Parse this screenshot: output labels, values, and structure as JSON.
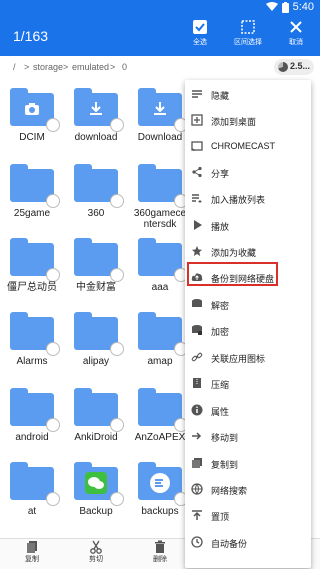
{
  "status": {
    "time": "5:40"
  },
  "appbar": {
    "count": "1/163",
    "select_all": "全选",
    "range_select": "区间选择",
    "cancel": "取消"
  },
  "breadcrumb": {
    "root": "/",
    "sep": ">",
    "storage": "storage",
    "emulated": "emulated",
    "current": "0",
    "storage_chip": "2.5..."
  },
  "files": [
    {
      "label": "DCIM",
      "glyph": "camera-icon"
    },
    {
      "label": "download",
      "glyph": "download-icon"
    },
    {
      "label": "Download",
      "glyph": "download-icon"
    },
    {
      "label": "25game",
      "glyph": ""
    },
    {
      "label": "360",
      "glyph": ""
    },
    {
      "label": "360gamece\nntersdk",
      "glyph": ""
    },
    {
      "label": "僵尸总动员",
      "glyph": ""
    },
    {
      "label": "中金财富",
      "glyph": ""
    },
    {
      "label": "aaa",
      "glyph": ""
    },
    {
      "label": "Alarms",
      "glyph": ""
    },
    {
      "label": "alipay",
      "glyph": ""
    },
    {
      "label": "amap",
      "glyph": ""
    },
    {
      "label": "android",
      "glyph": ""
    },
    {
      "label": "AnkiDroid",
      "glyph": ""
    },
    {
      "label": "AnZoAPEX",
      "glyph": ""
    },
    {
      "label": "at",
      "glyph": ""
    },
    {
      "label": "Backup",
      "glyph": "wechat-icon"
    },
    {
      "label": "backups",
      "glyph": "es-icon"
    }
  ],
  "menu": [
    {
      "label": "隐藏",
      "icon": "hide-icon"
    },
    {
      "label": "添加到桌面",
      "icon": "add-desktop-icon"
    },
    {
      "label": "CHROMECAST",
      "icon": "cast-icon"
    },
    {
      "label": "分享",
      "icon": "share-icon"
    },
    {
      "label": "加入播放列表",
      "icon": "playlist-icon"
    },
    {
      "label": "播放",
      "icon": "play-icon"
    },
    {
      "label": "添加为收藏",
      "icon": "star-icon"
    },
    {
      "label": "备份到网络硬盘",
      "icon": "cloud-upload-icon"
    },
    {
      "label": "解密",
      "icon": "decrypt-icon"
    },
    {
      "label": "加密",
      "icon": "encrypt-icon"
    },
    {
      "label": "关联应用图标",
      "icon": "link-icon"
    },
    {
      "label": "压缩",
      "icon": "compress-icon"
    },
    {
      "label": "属性",
      "icon": "info-icon"
    },
    {
      "label": "移动到",
      "icon": "move-icon"
    },
    {
      "label": "复制到",
      "icon": "copy-to-icon"
    },
    {
      "label": "网络搜索",
      "icon": "web-search-icon"
    },
    {
      "label": "置顶",
      "icon": "pin-top-icon"
    },
    {
      "label": "自动备份",
      "icon": "auto-backup-icon"
    }
  ],
  "bottom": {
    "copy": "复制",
    "cut": "剪切",
    "delete": "删除"
  },
  "colors": {
    "primary": "#1a73e8",
    "folder": "#5b9bf0",
    "highlight": "#d9302a"
  }
}
